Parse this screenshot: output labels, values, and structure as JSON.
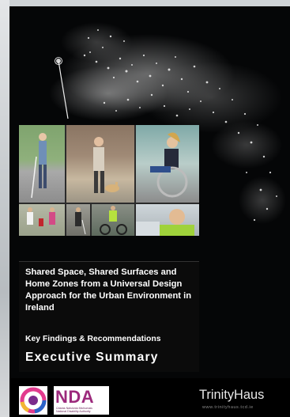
{
  "cover": {
    "title": "Shared Space, Shared Surfaces and Home Zones from a Universal Design Approach for the Urban Environment in Ireland",
    "subtitle": "Key Findings & Recommendations",
    "heading": "Executive Summary"
  },
  "logos": {
    "nda_letters": "NDA",
    "nda_line1": "Údarás Náisiúnta Míchumais",
    "nda_line2": "National Disability Authority",
    "trinity_name": "TrinityHaus",
    "trinity_url": "www.trinityhaus.tcd.ie"
  },
  "icons": {
    "first_logo": "circular-colour-logo-icon",
    "map": "night-lights-map-icon"
  }
}
